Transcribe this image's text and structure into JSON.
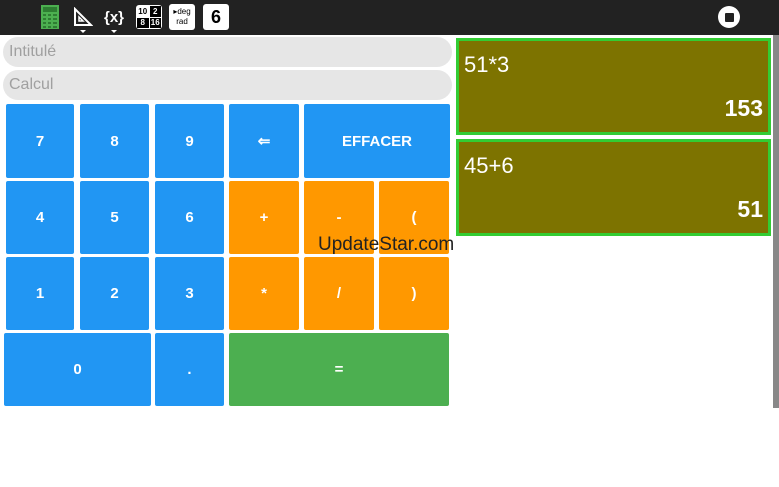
{
  "toolbar": {
    "icons": [
      {
        "name": "calculator-icon"
      },
      {
        "name": "geometry-icon"
      },
      {
        "name": "variables-icon",
        "label": "{x}"
      },
      {
        "name": "fraction-icon",
        "top_left": "10",
        "top_right": "2",
        "bottom_left": "8",
        "bottom_right": "16"
      },
      {
        "name": "angle-mode-icon",
        "line1": "▸deg",
        "line2": "rad"
      },
      {
        "name": "precision-icon",
        "label": "6"
      },
      {
        "name": "stop-icon"
      }
    ]
  },
  "fields": {
    "title_placeholder": "Intitulé",
    "calc_placeholder": "Calcul"
  },
  "keypad": {
    "k7": "7",
    "k8": "8",
    "k9": "9",
    "backspace": "⇐",
    "clear": "EFFACER",
    "k4": "4",
    "k5": "5",
    "k6": "6",
    "plus": "+",
    "minus": "-",
    "lparen": "(",
    "k1": "1",
    "k2": "2",
    "k3": "3",
    "times": "*",
    "divide": "/",
    "rparen": ")",
    "k0": "0",
    "dot": ".",
    "equals": "="
  },
  "history": [
    {
      "expression": "51*3",
      "result": "153"
    },
    {
      "expression": "45+6",
      "result": "51"
    }
  ],
  "watermark": "UpdateStar.com",
  "colors": {
    "toolbar": "#222222",
    "key_blue": "#2196F3",
    "key_orange": "#FF9800",
    "key_green": "#4CAF50",
    "card_bg": "#7d7300",
    "card_border": "#33cc33"
  }
}
